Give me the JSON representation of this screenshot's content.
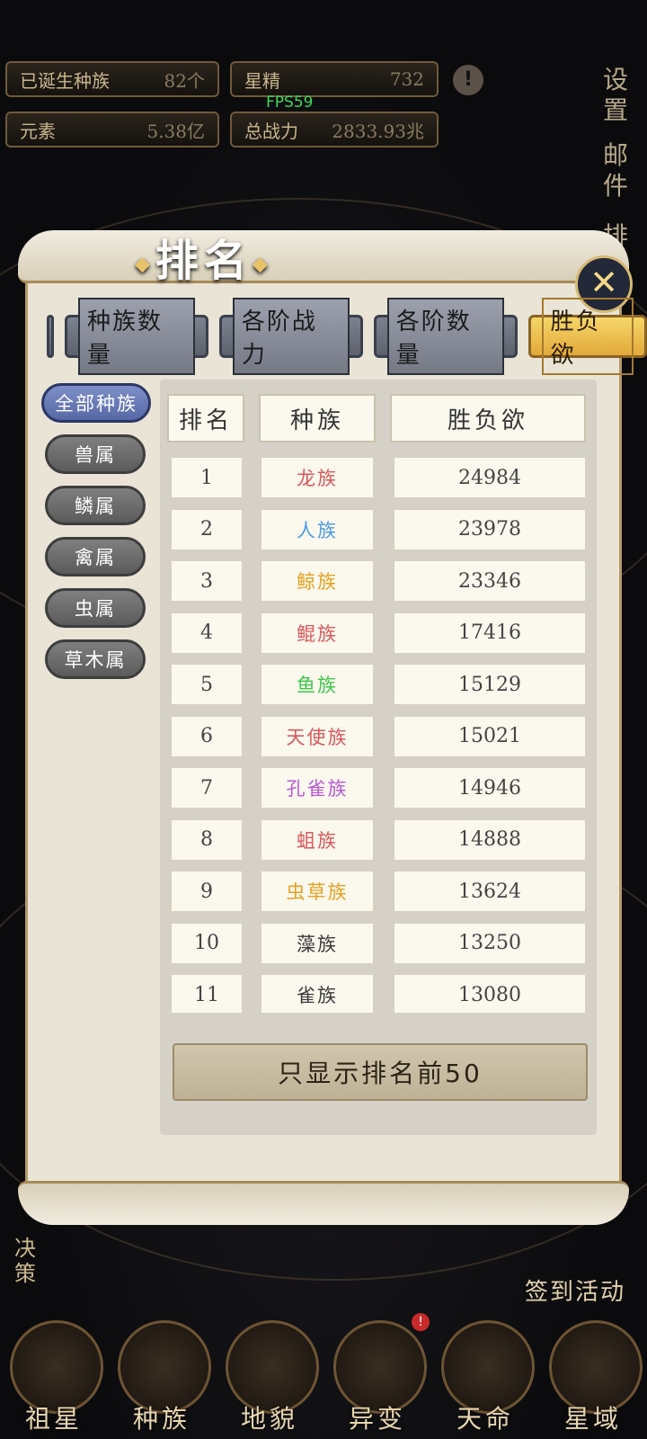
{
  "stats": {
    "born_label": "已诞生种族",
    "born_value": "82个",
    "essence_label": "星精",
    "essence_value": "732",
    "element_label": "元素",
    "element_value": "5.38亿",
    "power_label": "总战力",
    "power_value": "2833.93兆",
    "fps": "FPS59"
  },
  "side_right": [
    "设置",
    "邮件",
    "排"
  ],
  "dialog": {
    "title": "排名",
    "close_icon": "close-x-icon",
    "tabs": [
      "种族数量",
      "各阶战力",
      "各阶数量",
      "胜负欲"
    ],
    "active_tab": "胜负欲",
    "categories": [
      "全部种族",
      "兽属",
      "鳞属",
      "禽属",
      "虫属",
      "草木属"
    ],
    "active_category": "全部种族",
    "headers": {
      "rank": "排名",
      "race": "种族",
      "value": "胜负欲"
    },
    "rows": [
      {
        "rank": "1",
        "race": "龙族",
        "value": "24984",
        "color": "#d9585a"
      },
      {
        "rank": "2",
        "race": "人族",
        "value": "23978",
        "color": "#4a9be0"
      },
      {
        "rank": "3",
        "race": "鲸族",
        "value": "23346",
        "color": "#e6a11e"
      },
      {
        "rank": "4",
        "race": "鲲族",
        "value": "17416",
        "color": "#d9585a"
      },
      {
        "rank": "5",
        "race": "鱼族",
        "value": "15129",
        "color": "#3ec74a"
      },
      {
        "rank": "6",
        "race": "天使族",
        "value": "15021",
        "color": "#d9585a"
      },
      {
        "rank": "7",
        "race": "孔雀族",
        "value": "14946",
        "color": "#b85ad6"
      },
      {
        "rank": "8",
        "race": "蛆族",
        "value": "14888",
        "color": "#d9585a"
      },
      {
        "rank": "9",
        "race": "虫草族",
        "value": "13624",
        "color": "#e6a11e"
      },
      {
        "rank": "10",
        "race": "藻族",
        "value": "13250",
        "color": "#3a3a3a"
      },
      {
        "rank": "11",
        "race": "雀族",
        "value": "13080",
        "color": "#3a3a3a"
      }
    ],
    "footer_button": "只显示排名前50"
  },
  "decision_label": "决策",
  "signin_label": "签到活动",
  "nav": [
    "祖星",
    "种族",
    "地貌",
    "异变",
    "天命",
    "星域"
  ]
}
